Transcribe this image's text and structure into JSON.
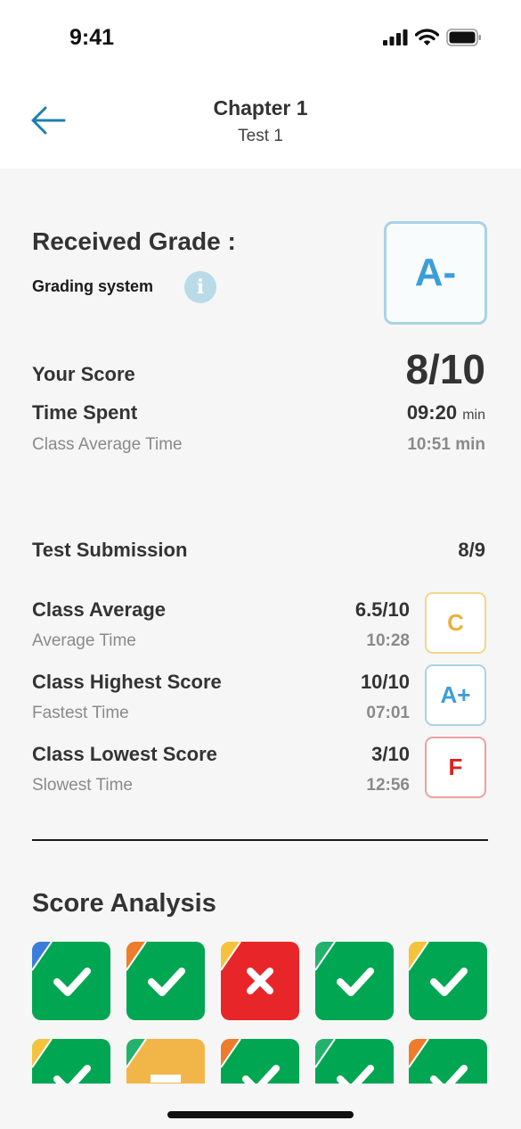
{
  "status_bar": {
    "time": "9:41"
  },
  "header": {
    "title": "Chapter 1",
    "subtitle": "Test 1"
  },
  "grade": {
    "label": "Received Grade :",
    "grading_system_label": "Grading system",
    "info_glyph": "i",
    "value": "A-"
  },
  "score": {
    "your_score_label": "Your Score",
    "your_score": "8/10",
    "time_spent_label": "Time Spent",
    "time_spent": "09:20",
    "time_spent_unit": "min",
    "class_avg_time_label": "Class Average Time",
    "class_avg_time": "10:51 min"
  },
  "submission": {
    "label": "Test Submission",
    "value": "8/9"
  },
  "class_stats": [
    {
      "label": "Class Average",
      "score": "6.5/10",
      "sub_label": "Average Time",
      "time": "10:28",
      "grade": "C",
      "color": "#e8b33a",
      "border": "#f2d68c"
    },
    {
      "label": "Class Highest Score",
      "score": "10/10",
      "sub_label": "Fastest Time",
      "time": "07:01",
      "grade": "A+",
      "color": "#3c9ed8",
      "border": "#a9d3e4"
    },
    {
      "label": "Class Lowest Score",
      "score": "3/10",
      "sub_label": "Slowest Time",
      "time": "12:56",
      "grade": "F",
      "color": "#e02020",
      "border": "#eda0a0"
    }
  ],
  "score_analysis": {
    "title": "Score Analysis",
    "items": [
      {
        "result": "correct",
        "difficulty_color": "#3b7ddd"
      },
      {
        "result": "correct",
        "difficulty_color": "#ee7c2b"
      },
      {
        "result": "wrong",
        "difficulty_color": "#f5c33b"
      },
      {
        "result": "correct",
        "difficulty_color": "#23b26d"
      },
      {
        "result": "correct",
        "difficulty_color": "#f5c33b"
      },
      {
        "result": "correct",
        "difficulty_color": "#f5c33b"
      },
      {
        "result": "pending",
        "difficulty_color": "#23b26d"
      },
      {
        "result": "correct",
        "difficulty_color": "#ee7c2b"
      },
      {
        "result": "correct",
        "difficulty_color": "#23b26d"
      },
      {
        "result": "correct",
        "difficulty_color": "#ee7c2b"
      }
    ],
    "result_colors": {
      "correct": "#00a651",
      "wrong": "#e8262a",
      "pending": "#f2b648"
    },
    "icons": {
      "correct": "checkmark-icon",
      "wrong": "x-mark-icon",
      "pending": "pending-icon"
    }
  }
}
